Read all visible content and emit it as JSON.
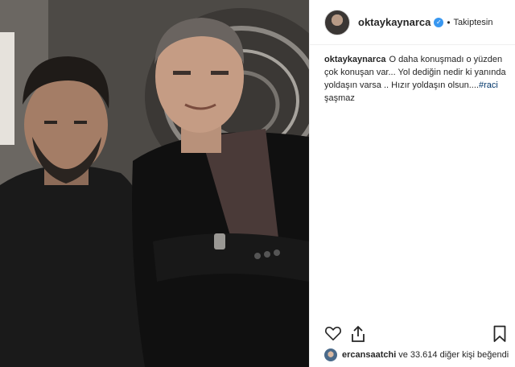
{
  "post": {
    "username": "oktaykaynarca",
    "follow_status": "Takiptesin",
    "caption_user": "oktaykaynarca",
    "caption_text": "O daha konuşmadı o yüzden çok konuşan var... Yol dediğin nedir ki yanında yoldaşın varsa .. Hızır yoldaşın olsun....",
    "hashtag": "#raci",
    "caption_tail": "şaşmaz",
    "verified_icon": "verified-badge-icon"
  },
  "likes": {
    "user": "ercansaatchi",
    "connector": "ve",
    "count_text": "33.614 diğer kişi",
    "suffix": "beğendi"
  },
  "icons": {
    "like": "heart-icon",
    "share": "share-icon",
    "save": "bookmark-icon"
  },
  "colors": {
    "verified": "#3897f0",
    "hashtag": "#003569",
    "text": "#262626",
    "border": "#efefef"
  }
}
